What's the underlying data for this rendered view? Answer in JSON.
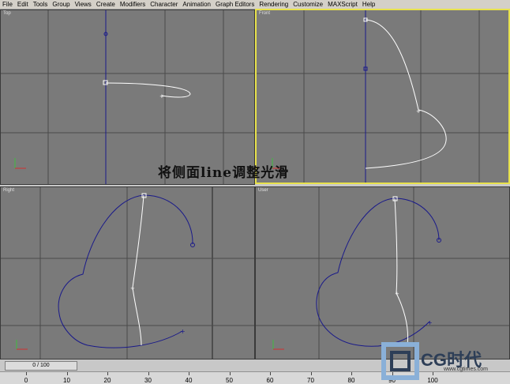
{
  "menu": [
    "File",
    "Edit",
    "Tools",
    "Group",
    "Views",
    "Create",
    "Modifiers",
    "Character",
    "Animation",
    "Graph Editors",
    "Rendering",
    "Customize",
    "MAXScript",
    "Help"
  ],
  "viewports": {
    "top": {
      "label": "Top"
    },
    "front": {
      "label": "Front"
    },
    "left": {
      "label": "Right"
    },
    "user": {
      "label": "User"
    }
  },
  "caption": "将侧面line调整光滑",
  "timeline": {
    "slider_text": "0 / 100",
    "ticks": [
      "0",
      "10",
      "20",
      "30",
      "40",
      "50",
      "60",
      "70",
      "80",
      "90",
      "100"
    ]
  },
  "logo": {
    "text": "CG时代",
    "watermark": "www.cgtimes.com"
  }
}
